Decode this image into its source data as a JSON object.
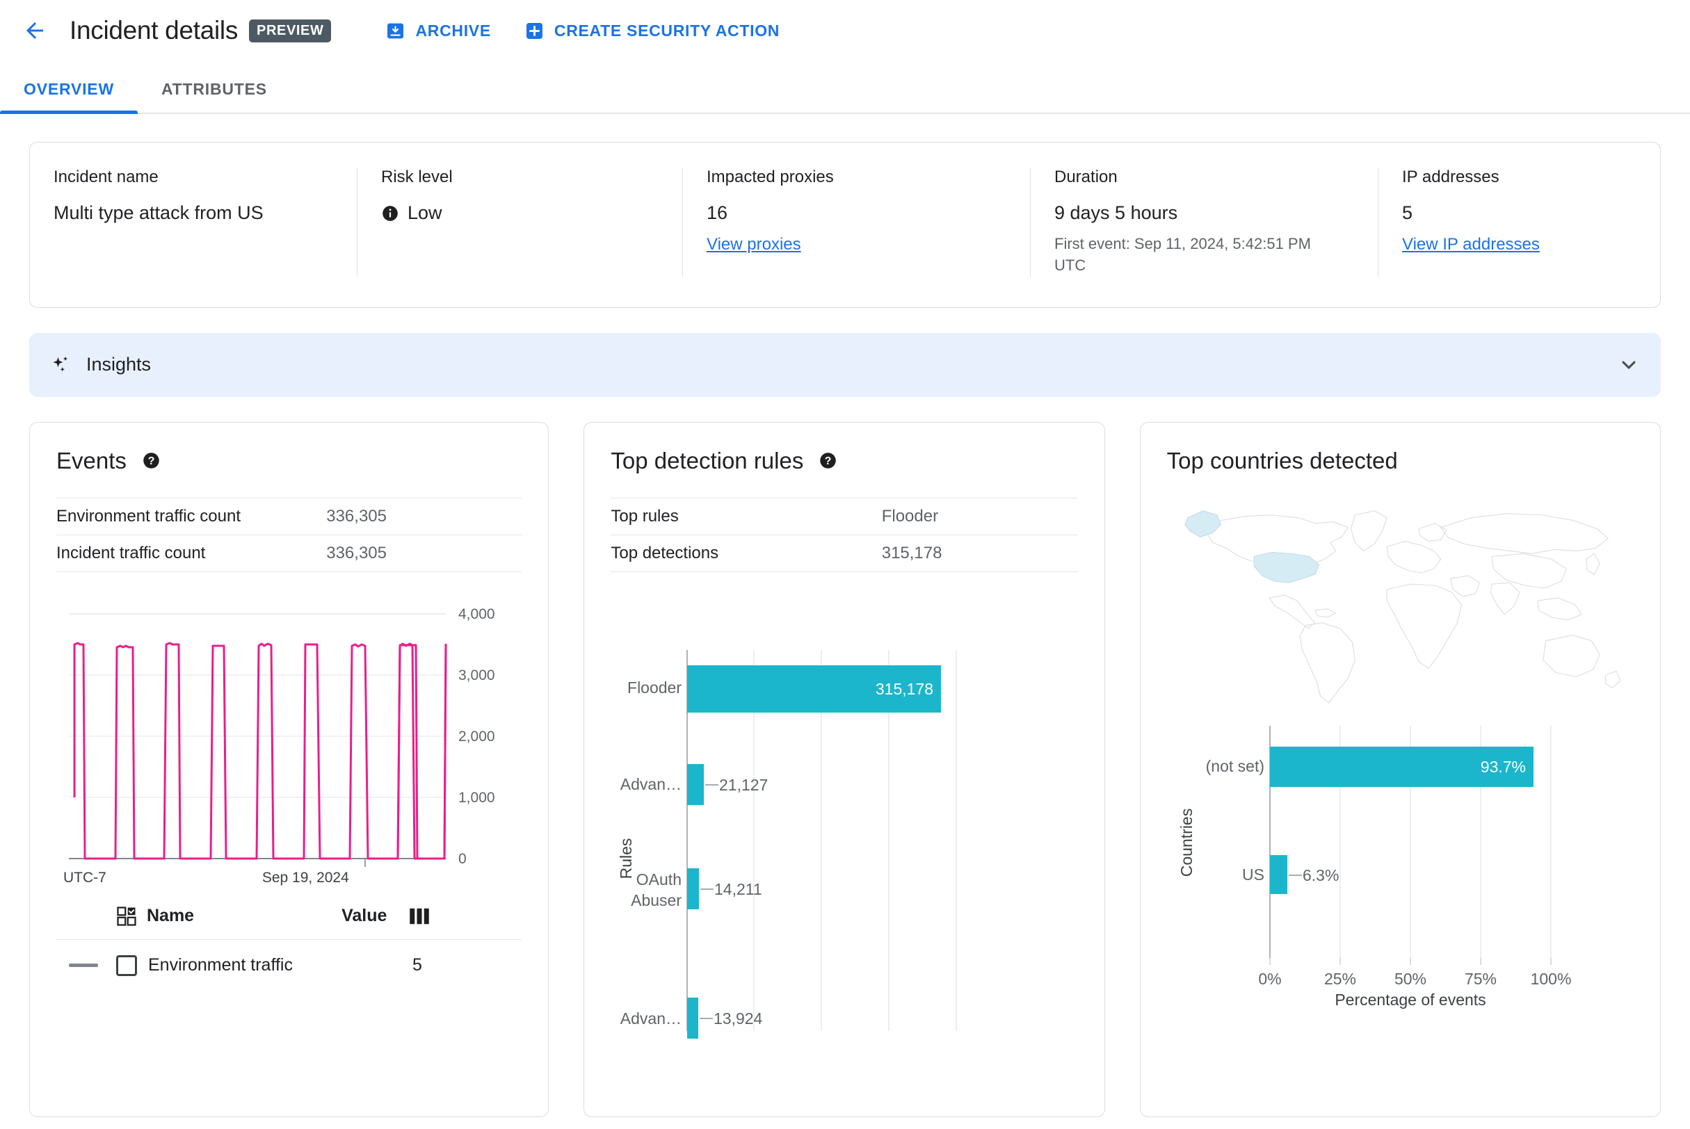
{
  "header": {
    "back_label": "back-arrow",
    "title": "Incident details",
    "preview_badge": "PREVIEW",
    "actions": [
      {
        "label": "ARCHIVE",
        "icon": "archive-icon"
      },
      {
        "label": "CREATE SECURITY ACTION",
        "icon": "plus-box-icon"
      }
    ]
  },
  "tabs": [
    {
      "label": "OVERVIEW",
      "active": true
    },
    {
      "label": "ATTRIBUTES",
      "active": false
    }
  ],
  "summary": {
    "incident_name": {
      "label": "Incident name",
      "value": "Multi type attack from US"
    },
    "risk_level": {
      "label": "Risk level",
      "value": "Low",
      "icon": "info-icon"
    },
    "impacted_proxies": {
      "label": "Impacted proxies",
      "value": "16",
      "link": "View proxies"
    },
    "duration": {
      "label": "Duration",
      "value": "9 days 5 hours",
      "sub": "First event: Sep 11, 2024, 5:42:51 PM UTC"
    },
    "ip_addresses": {
      "label": "IP addresses",
      "value": "5",
      "link": "View IP addresses"
    }
  },
  "insights": {
    "title": "Insights",
    "icon": "sparkle-icon",
    "chevron": "chevron-down-icon"
  },
  "events_panel": {
    "title": "Events",
    "help_icon": "help-icon",
    "stats": [
      {
        "key": "Environment traffic count",
        "value": "336,305"
      },
      {
        "key": "Incident traffic count",
        "value": "336,305"
      }
    ],
    "legend": {
      "name_header": "Name",
      "value_header": "Value",
      "select_icon": "select-all-icon",
      "columns_icon": "columns-icon",
      "rows": [
        {
          "name": "Environment traffic",
          "value": "5"
        }
      ]
    }
  },
  "rules_panel": {
    "title": "Top detection rules",
    "help_icon": "help-icon",
    "stats": [
      {
        "key": "Top rules",
        "value": "Flooder"
      },
      {
        "key": "Top detections",
        "value": "315,178"
      }
    ]
  },
  "countries_panel": {
    "title": "Top countries detected",
    "map_icon": "world-map",
    "highlighted": [
      "US",
      "Alaska"
    ]
  },
  "colors": {
    "accent_blue": "#1a73e8",
    "teal_bar": "#1bb6cc",
    "pink_line": "#e91e8c",
    "insights_bg": "#e8f0fe",
    "map_highlight": "#d6ecf4",
    "badge_bg": "#4e5a63"
  },
  "chart_data": [
    {
      "type": "line",
      "title": "Events",
      "xlabel": "UTC-7",
      "ylabel": "",
      "ylim": [
        0,
        4000
      ],
      "yticks": [
        0,
        1000,
        2000,
        3000,
        4000
      ],
      "ytick_labels": [
        "0",
        "1,000",
        "2,000",
        "3,000",
        "4,000"
      ],
      "xtick_labels": [
        "UTC-7",
        "Sep 19, 2024"
      ],
      "grid": true,
      "legend_position": "below",
      "series": [
        {
          "name": "Environment traffic",
          "color": "#e91e8c",
          "pattern": "sawtooth",
          "cycles": 9,
          "peak": 3500,
          "trough": 0,
          "start_value": 1000,
          "values": [
            1000,
            3500,
            3500,
            0,
            3450,
            3480,
            3450,
            0,
            3500,
            3500,
            0,
            3480,
            3480,
            0,
            3460,
            3520,
            3470,
            0,
            3500,
            3500,
            0,
            3470,
            3500,
            3460,
            0,
            3470,
            3510,
            3470,
            0,
            3490,
            3490,
            0,
            3490,
            3490
          ]
        }
      ]
    },
    {
      "type": "bar",
      "orientation": "horizontal",
      "title": "Top detection rules",
      "ylabel": "Rules",
      "xlabel": "",
      "categories": [
        "Flooder",
        "Advan…",
        "OAuth Abuser",
        "Advan…"
      ],
      "values": [
        315178,
        21127,
        14211,
        13924
      ],
      "value_labels": [
        "315,178",
        "21,127",
        "14,211",
        "13,924"
      ],
      "xlim": [
        0,
        360000
      ],
      "grid": true,
      "bar_color": "#1bb6cc"
    },
    {
      "type": "bar",
      "orientation": "horizontal",
      "title": "Top countries detected",
      "ylabel": "Countries",
      "xlabel": "Percentage of events",
      "categories": [
        "(not set)",
        "US"
      ],
      "values": [
        93.7,
        6.3
      ],
      "value_labels": [
        "93.7%",
        "6.3%"
      ],
      "xlim": [
        0,
        100
      ],
      "xticks": [
        0,
        25,
        50,
        75,
        100
      ],
      "xtick_labels": [
        "0%",
        "25%",
        "50%",
        "75%",
        "100%"
      ],
      "grid": true,
      "bar_color": "#1bb6cc"
    }
  ]
}
